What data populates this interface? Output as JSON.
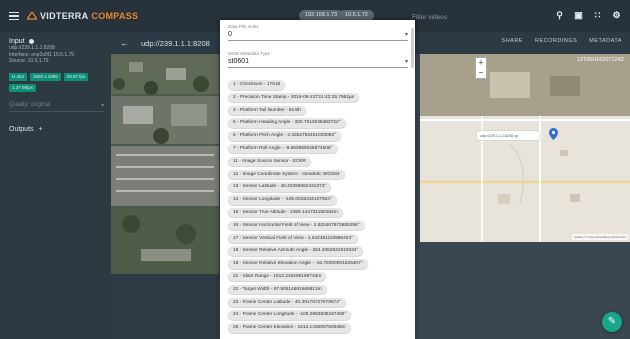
{
  "topbar": {
    "logo_name": "VIDTERRA",
    "logo_sub": "COMPASS",
    "ip_chips": [
      "192.168.1.73",
      "10.5.1.72"
    ],
    "filter_placeholder": "Filter videos"
  },
  "sidebar": {
    "title": "Input",
    "lines": [
      "udp://239.1.1.1:8208",
      "Interface: enp2s0f1 10.5.1.75",
      "Source: 10.5.1.75"
    ],
    "chips": [
      "H.264",
      "1920 x 1080",
      "29.97 fps",
      "1.37 Mbps"
    ],
    "quality_label": "Quality: original",
    "outputs_label": "Outputs",
    "outputs_add": "+"
  },
  "video_header": {
    "stream": "udp://239.1.1.1:8208",
    "actions": [
      "SHARE",
      "RECORDINGS",
      "METADATA"
    ]
  },
  "map": {
    "timestamp": "13T05H16207124Z",
    "chip": "udp://239.1.1.1:8208 op",
    "zoom_in": "+",
    "zoom_out": "−",
    "attribution": "Leaflet | © OpenStreetMap contributors"
  },
  "dialog": {
    "pid_label": "Data PID Index",
    "pid_value": "0",
    "type_label": "MISB Metadata Type",
    "type_value": "st0601",
    "items": [
      "1 - Checksum - 17518",
      "2 - Precision Time Stamp - 2016-08-21T21:42:25.7962µs",
      "4 - Platform Tail Number - 514th",
      "5 - Platform Heading Angle - 320.7013048483722°",
      "6 - Platform Pitch Angle - 2.3352783451033083°",
      "7 - Platform Roll Angle - -8.663889025574508°",
      "11 - Image Source Sensor - EO/IR",
      "12 - Image Coordinate System - Geodetic WGS84",
      "13 - Sensor Latitude - 40.40259062431373°",
      "14 - Sensor Longitude - -105.0815316107924°",
      "15 - Sensor True Altitude - 2369.144731182284m",
      "16 - Sensor Horizontal Field of View - 2.922407973655296°",
      "17 - Sensor Vertical Field of View - 1.642481116980403°",
      "18 - Sensor Relative Azimuth Angle - 264.4062531810034°",
      "19 - Sensor Relative Elevation Angle - -16.75000001525407°",
      "21 - Slant Range - 1912.216286169743m",
      "22 - Target Width - 97.50514691669813m",
      "23 - Frame Center Latitude - 40.39178727678572°",
      "24 - Frame Center Longitude - -105.0963835167465°",
      "25 - Frame Center Elevation - 1513.143500762848m"
    ]
  }
}
